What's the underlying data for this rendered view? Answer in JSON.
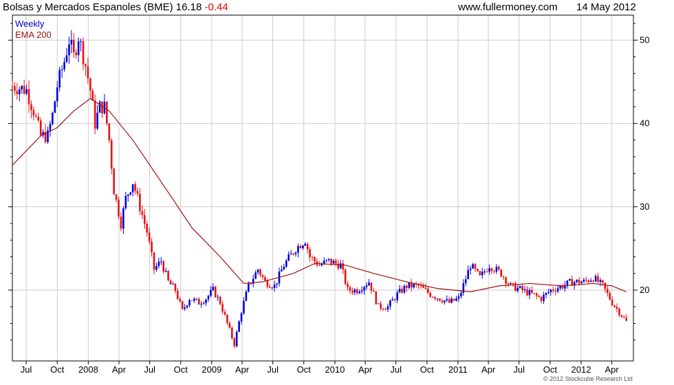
{
  "header": {
    "title": "Bolsas y Mercados Espanoles (BME)",
    "last_price": "16.18",
    "change": "-0.44",
    "site": "www.fullermoney.com",
    "date": "14 May 2012"
  },
  "legend": {
    "weekly": "Weekly",
    "ema": "EMA 200"
  },
  "copyright": "© 2012 Stockcube Research Ltd",
  "colors": {
    "up": "#0000d8",
    "down": "#e81010",
    "ema": "#a01010",
    "grid": "#cccccc"
  },
  "chart_data": {
    "type": "line",
    "chart_style": "weekly candlestick",
    "ylim": [
      11.5,
      53
    ],
    "yticks": [
      20,
      30,
      40,
      50
    ],
    "x_tick_labels": [
      "Jul",
      "Oct",
      "2008",
      "Apr",
      "Jul",
      "Oct",
      "2009",
      "Apr",
      "Jul",
      "Oct",
      "2010",
      "Apr",
      "Jul",
      "Oct",
      "2011",
      "Apr",
      "Jul",
      "Oct",
      "2012",
      "Apr"
    ],
    "x_tick_dates": [
      "2007-07-01",
      "2007-10-01",
      "2008-01-01",
      "2008-04-01",
      "2008-07-01",
      "2008-10-01",
      "2009-01-01",
      "2009-04-01",
      "2009-07-01",
      "2009-10-01",
      "2010-01-01",
      "2010-04-01",
      "2010-07-01",
      "2010-10-01",
      "2011-01-01",
      "2011-04-01",
      "2011-07-01",
      "2011-10-01",
      "2012-01-01",
      "2012-04-01"
    ],
    "x_range": [
      "2007-05-21",
      "2012-06-04"
    ],
    "grid": true,
    "legend_position": "top-left",
    "series": [
      {
        "name": "Weekly",
        "style": "candlestick-close",
        "points": [
          [
            "2007-05-21",
            44.5
          ],
          [
            "2007-06-18",
            44.2
          ],
          [
            "2007-07-02",
            44.0
          ],
          [
            "2007-07-23",
            41.5
          ],
          [
            "2007-08-13",
            38.5
          ],
          [
            "2007-09-03",
            38.5
          ],
          [
            "2007-09-17",
            41.0
          ],
          [
            "2007-10-01",
            44.5
          ],
          [
            "2007-10-22",
            47.5
          ],
          [
            "2007-11-05",
            50.0
          ],
          [
            "2007-11-19",
            48.0
          ],
          [
            "2007-12-03",
            50.5
          ],
          [
            "2007-12-24",
            47.0
          ],
          [
            "2008-01-07",
            44.0
          ],
          [
            "2008-01-21",
            40.0
          ],
          [
            "2008-02-04",
            42.0
          ],
          [
            "2008-02-18",
            42.0
          ],
          [
            "2008-03-03",
            38.0
          ],
          [
            "2008-03-17",
            32.0
          ],
          [
            "2008-04-07",
            28.0
          ],
          [
            "2008-04-21",
            31.0
          ],
          [
            "2008-05-12",
            33.0
          ],
          [
            "2008-06-02",
            30.0
          ],
          [
            "2008-06-23",
            27.0
          ],
          [
            "2008-07-14",
            22.5
          ],
          [
            "2008-08-04",
            23.5
          ],
          [
            "2008-08-25",
            21.0
          ],
          [
            "2008-09-15",
            20.0
          ],
          [
            "2008-10-06",
            17.5
          ],
          [
            "2008-10-27",
            19.0
          ],
          [
            "2008-11-24",
            18.5
          ],
          [
            "2008-12-15",
            19.0
          ],
          [
            "2009-01-05",
            20.0
          ],
          [
            "2009-01-26",
            18.5
          ],
          [
            "2009-02-16",
            16.0
          ],
          [
            "2009-03-09",
            13.5
          ],
          [
            "2009-03-30",
            17.5
          ],
          [
            "2009-04-20",
            20.5
          ],
          [
            "2009-05-18",
            22.5
          ],
          [
            "2009-06-08",
            21.0
          ],
          [
            "2009-07-06",
            20.5
          ],
          [
            "2009-08-03",
            23.0
          ],
          [
            "2009-09-07",
            25.0
          ],
          [
            "2009-10-05",
            26.0
          ],
          [
            "2009-10-19",
            24.0
          ],
          [
            "2009-11-16",
            23.0
          ],
          [
            "2009-12-14",
            23.5
          ],
          [
            "2010-01-18",
            23.0
          ],
          [
            "2010-02-08",
            20.0
          ],
          [
            "2010-03-08",
            20.0
          ],
          [
            "2010-04-12",
            21.0
          ],
          [
            "2010-05-10",
            18.0
          ],
          [
            "2010-06-07",
            18.0
          ],
          [
            "2010-07-05",
            19.5
          ],
          [
            "2010-08-02",
            20.5
          ],
          [
            "2010-09-06",
            20.5
          ],
          [
            "2010-10-11",
            19.5
          ],
          [
            "2010-11-08",
            19.0
          ],
          [
            "2010-12-06",
            18.5
          ],
          [
            "2011-01-03",
            19.0
          ],
          [
            "2011-02-07",
            23.0
          ],
          [
            "2011-03-07",
            21.5
          ],
          [
            "2011-04-04",
            23.0
          ],
          [
            "2011-05-09",
            22.0
          ],
          [
            "2011-06-06",
            20.5
          ],
          [
            "2011-07-11",
            20.0
          ],
          [
            "2011-08-08",
            19.5
          ],
          [
            "2011-09-05",
            19.0
          ],
          [
            "2011-10-03",
            20.0
          ],
          [
            "2011-11-07",
            20.5
          ],
          [
            "2011-12-05",
            21.0
          ],
          [
            "2012-01-09",
            21.0
          ],
          [
            "2012-02-06",
            21.5
          ],
          [
            "2012-03-05",
            20.5
          ],
          [
            "2012-04-02",
            18.5
          ],
          [
            "2012-04-30",
            17.0
          ],
          [
            "2012-05-14",
            16.2
          ]
        ]
      },
      {
        "name": "EMA 200",
        "style": "line",
        "points": [
          [
            "2007-05-21",
            35.0
          ],
          [
            "2007-08-13",
            38.5
          ],
          [
            "2007-10-01",
            39.5
          ],
          [
            "2007-11-19",
            41.5
          ],
          [
            "2008-01-07",
            43.0
          ],
          [
            "2008-03-03",
            41.5
          ],
          [
            "2008-05-12",
            38.0
          ],
          [
            "2008-08-04",
            33.0
          ],
          [
            "2008-11-03",
            27.5
          ],
          [
            "2009-01-26",
            24.0
          ],
          [
            "2009-04-06",
            20.8
          ],
          [
            "2009-06-01",
            21.0
          ],
          [
            "2009-08-31",
            22.0
          ],
          [
            "2009-11-02",
            23.2
          ],
          [
            "2010-02-01",
            23.0
          ],
          [
            "2010-04-26",
            22.0
          ],
          [
            "2010-08-02",
            21.0
          ],
          [
            "2010-11-01",
            20.2
          ],
          [
            "2011-02-07",
            19.8
          ],
          [
            "2011-05-02",
            20.5
          ],
          [
            "2011-08-01",
            20.8
          ],
          [
            "2011-11-07",
            20.5
          ],
          [
            "2012-02-06",
            20.8
          ],
          [
            "2012-04-02",
            20.5
          ],
          [
            "2012-05-14",
            19.8
          ]
        ]
      }
    ]
  }
}
